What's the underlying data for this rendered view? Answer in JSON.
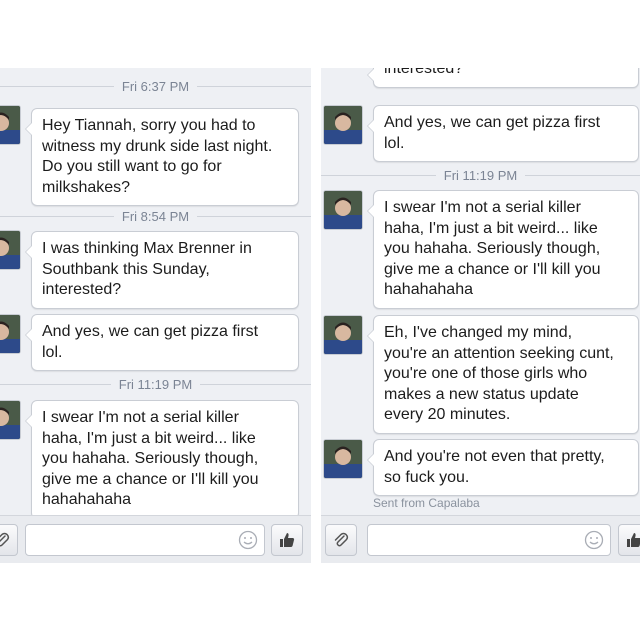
{
  "left_panel": {
    "timestamps": [
      "Fri 6:37 PM",
      "Fri 8:54 PM",
      "Fri 11:19 PM"
    ],
    "messages": [
      "Hey Tiannah, sorry you had to\nwitness my drunk side last night.\nDo you still want to go for\nmilkshakes?",
      "I was thinking Max Brenner in\nSouthbank this Sunday,\ninterested?",
      "And yes, we can get pizza first\nlol.",
      "I swear I'm not a serial killer\nhaha, I'm just a bit weird... like\nyou hahaha. Seriously though,\ngive me a chance or I'll kill you\nhahahahaha"
    ]
  },
  "right_panel": {
    "top_fragment": "interested?",
    "timestamps": [
      "Fri 11:19 PM"
    ],
    "messages": [
      "And yes, we can get pizza first\nlol.",
      "I swear I'm not a serial killer\nhaha, I'm just a bit weird... like\nyou hahaha. Seriously though,\ngive me a chance or I'll kill you\nhahahahaha",
      "Eh, I've changed my mind,\nyou're an attention  seeking cunt,\nyou're one of those girls who\nmakes a new status update\nevery 20 minutes.",
      "And you're not even that pretty,\nso fuck you."
    ],
    "sent_from": "Sent from Capalaba"
  },
  "composer": {
    "left_input_value": "",
    "right_input_value": "",
    "icons": [
      "paperclip-icon",
      "smiley-icon",
      "thumbs-up-icon"
    ]
  },
  "colors": {
    "panel_bg": "#eef0f4",
    "bubble_border": "#c9cdd4",
    "timestamp_text": "#7b8494"
  }
}
